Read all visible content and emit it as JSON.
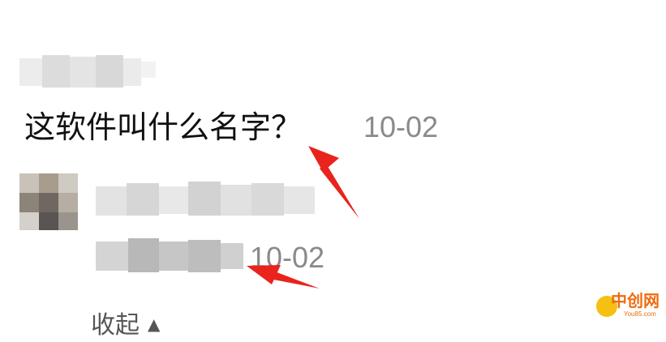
{
  "comment": {
    "text": "这软件叫什么名字？",
    "time": "10-02"
  },
  "reply": {
    "time": "10-02"
  },
  "collapse": {
    "label": "收起",
    "icon": "chevron-up-icon"
  },
  "watermark": {
    "name": "中创网",
    "url": "You85.com"
  },
  "colors": {
    "text": "#111111",
    "timestamp": "#8a8a8a",
    "arrow": "#e8241c",
    "watermark_orange": "#ef6b10",
    "watermark_yellow": "#f6c012"
  }
}
